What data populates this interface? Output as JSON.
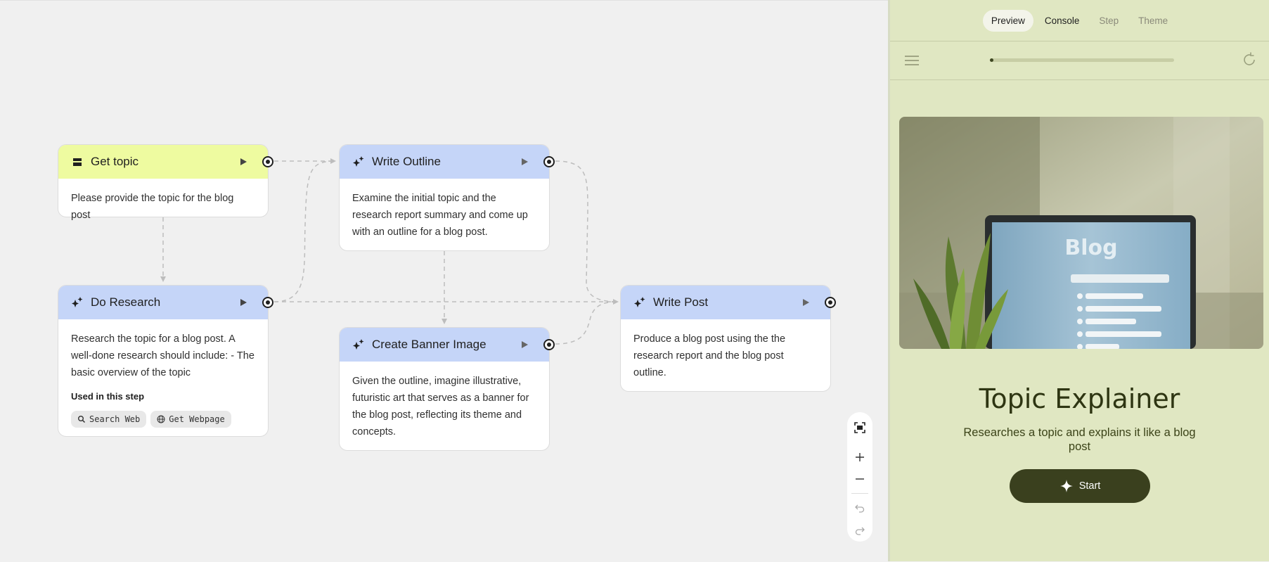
{
  "canvas": {
    "nodes": {
      "get_topic": {
        "title": "Get topic",
        "body": "Please provide the topic for the blog post"
      },
      "do_research": {
        "title": "Do Research",
        "body": "Research the topic for a blog post. A well-done research should include: - The basic overview of the topic",
        "used_label": "Used in this step",
        "tools": [
          "Search Web",
          "Get Webpage"
        ]
      },
      "write_outline": {
        "title": "Write Outline",
        "body": "Examine the initial topic and the research report summary and come up with an outline for a blog post."
      },
      "create_banner": {
        "title": "Create Banner Image",
        "body": "Given the outline, imagine illustrative, futuristic art that serves as a banner for the blog post, reflecting its theme and concepts."
      },
      "write_post": {
        "title": "Write Post",
        "body": "Produce a blog post using the the research report and the blog post outline."
      }
    },
    "colors": {
      "input_header": "#eefba0",
      "generate_header": "#c5d5f8"
    }
  },
  "panel": {
    "tabs": [
      "Preview",
      "Console",
      "Step",
      "Theme"
    ],
    "active_tab": "Preview",
    "progress": 0.02,
    "app": {
      "title": "Topic Explainer",
      "description": "Researches a topic and explains it like a blog post",
      "start_label": "Start"
    },
    "banner_text": "Blog",
    "colors": {
      "background": "#e0e7c2",
      "button": "#3a401e"
    }
  }
}
